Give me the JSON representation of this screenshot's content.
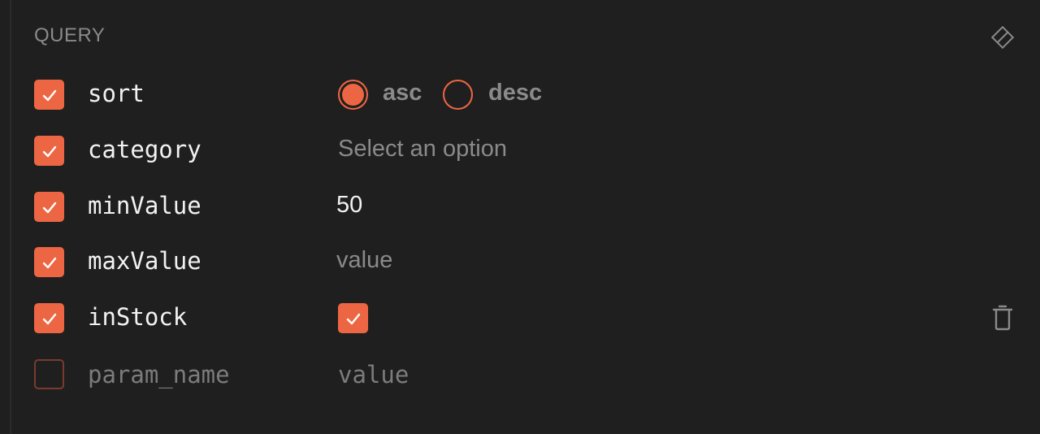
{
  "section": {
    "title": "QUERY",
    "header_icon": "eraser-icon"
  },
  "colors": {
    "accent": "#ed6643",
    "background": "#201f1f",
    "text": "#f2f2f2",
    "muted": "#8a8a8a"
  },
  "params": [
    {
      "name": "sort",
      "enabled": true,
      "type": "radio",
      "options": [
        "asc",
        "desc"
      ],
      "selected": "asc"
    },
    {
      "name": "category",
      "enabled": true,
      "type": "select",
      "placeholder": "Select an option"
    },
    {
      "name": "minValue",
      "enabled": true,
      "type": "number",
      "value": "50"
    },
    {
      "name": "maxValue",
      "enabled": true,
      "type": "number",
      "placeholder": "value"
    },
    {
      "name": "inStock",
      "enabled": true,
      "type": "boolean",
      "value": true,
      "row_icon": "trash-icon"
    },
    {
      "name": "param_name",
      "enabled": false,
      "type": "new",
      "placeholder": "value"
    }
  ]
}
